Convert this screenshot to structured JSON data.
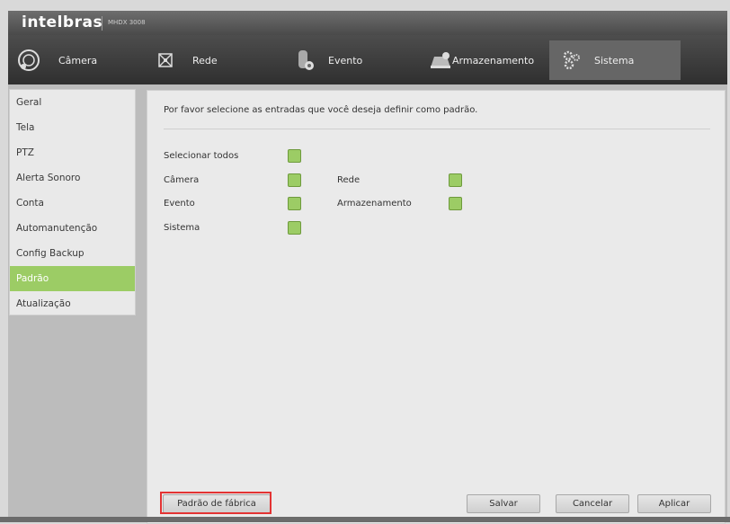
{
  "header": {
    "brand": "intelbras",
    "model": "MHDX 3008"
  },
  "tabs": [
    {
      "label": "Câmera",
      "icon": "camera-lens-icon"
    },
    {
      "label": "Rede",
      "icon": "network-icon"
    },
    {
      "label": "Evento",
      "icon": "event-icon"
    },
    {
      "label": "Armazenamento",
      "icon": "storage-icon"
    },
    {
      "label": "Sistema",
      "icon": "gears-icon",
      "active": true
    }
  ],
  "sidebar": {
    "items": [
      "Geral",
      "Tela",
      "PTZ",
      "Alerta Sonoro",
      "Conta",
      "Automanutenção",
      "Config Backup",
      "Padrão",
      "Atualização"
    ],
    "active": "Padrão"
  },
  "content": {
    "instruction": "Por favor selecione as entradas que você deseja definir como padrão.",
    "select_all": "Selecionar todos",
    "options": {
      "camera": "Câmera",
      "rede": "Rede",
      "evento": "Evento",
      "armazenamento": "Armazenamento",
      "sistema": "Sistema"
    }
  },
  "buttons": {
    "factory": "Padrão de fábrica",
    "save": "Salvar",
    "cancel": "Cancelar",
    "apply": "Aplicar"
  },
  "colors": {
    "accent": "#9ccc65",
    "highlight": "#e33333"
  }
}
